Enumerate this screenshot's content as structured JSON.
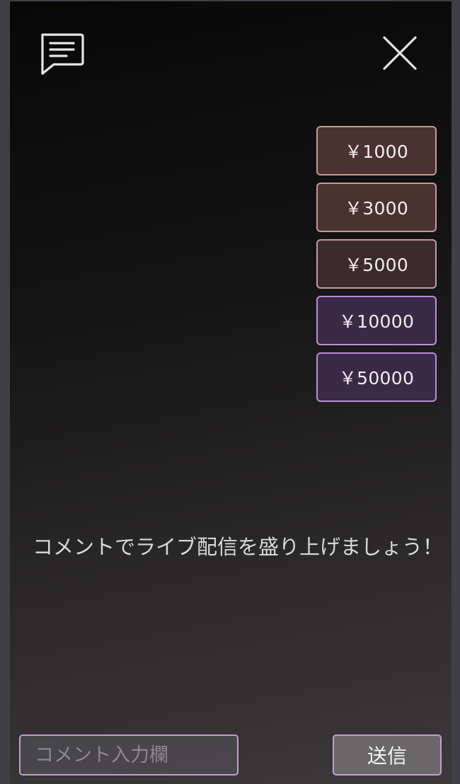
{
  "header": {
    "chat_icon": "chat-bubble-icon",
    "close_icon": "close-icon"
  },
  "amounts": [
    {
      "label": "￥1000"
    },
    {
      "label": "￥3000"
    },
    {
      "label": "￥5000"
    },
    {
      "label": "￥10000"
    },
    {
      "label": "￥50000"
    }
  ],
  "prompt": "コメントでライブ配信を盛り上げましょう！",
  "comment": {
    "value": "",
    "placeholder": "コメント入力欄"
  },
  "send_label": "送信",
  "colors": {
    "accent_purple": "#c79ad6",
    "accent_warm": "#c89a8e"
  }
}
